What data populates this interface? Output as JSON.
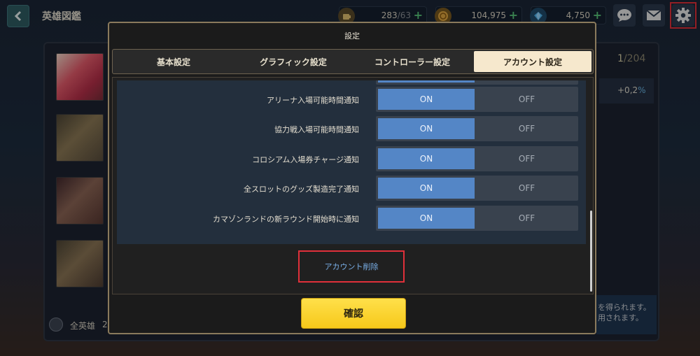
{
  "page_title": "英雄図鑑",
  "currencies": [
    {
      "icon": "stamina-icon",
      "value": "283",
      "max": "/63",
      "color": "#e0c070"
    },
    {
      "icon": "gold-coin-icon",
      "value": "104,975",
      "max": "",
      "color": "#e0a640"
    },
    {
      "icon": "gem-icon",
      "value": "4,750",
      "max": "",
      "color": "#4fb4ee"
    }
  ],
  "background": {
    "count_current": "1",
    "count_total": "/204",
    "rate_value": "+0,2",
    "rate_unit": "%",
    "filter_label": "全英雄",
    "filter_count": "2",
    "note_line1": "を得られます。",
    "note_line2": "用されます。"
  },
  "modal": {
    "title": "設定",
    "tabs": [
      {
        "label": "基本設定",
        "active": false
      },
      {
        "label": "グラフィック設定",
        "active": false
      },
      {
        "label": "コントローラー設定",
        "active": false
      },
      {
        "label": "アカウント設定",
        "active": true
      }
    ],
    "settings": [
      {
        "label": "アリーナ入場可能時間通知",
        "on": "ON",
        "off": "OFF",
        "selected": "ON"
      },
      {
        "label": "協力戦入場可能時間通知",
        "on": "ON",
        "off": "OFF",
        "selected": "ON"
      },
      {
        "label": "コロシアム入場券チャージ通知",
        "on": "ON",
        "off": "OFF",
        "selected": "ON"
      },
      {
        "label": "全スロットのグッズ製造完了通知",
        "on": "ON",
        "off": "OFF",
        "selected": "ON"
      },
      {
        "label": "カマゾンランドの新ラウンド開始時に通知",
        "on": "ON",
        "off": "OFF",
        "selected": "ON"
      }
    ],
    "delete_account_label": "アカウント削除",
    "confirm_label": "確認"
  },
  "colors": {
    "on_active": "#5486c6",
    "confirm_button": "#f6c81a",
    "highlight_box": "#e0303a",
    "link_text": "#79aee6"
  }
}
